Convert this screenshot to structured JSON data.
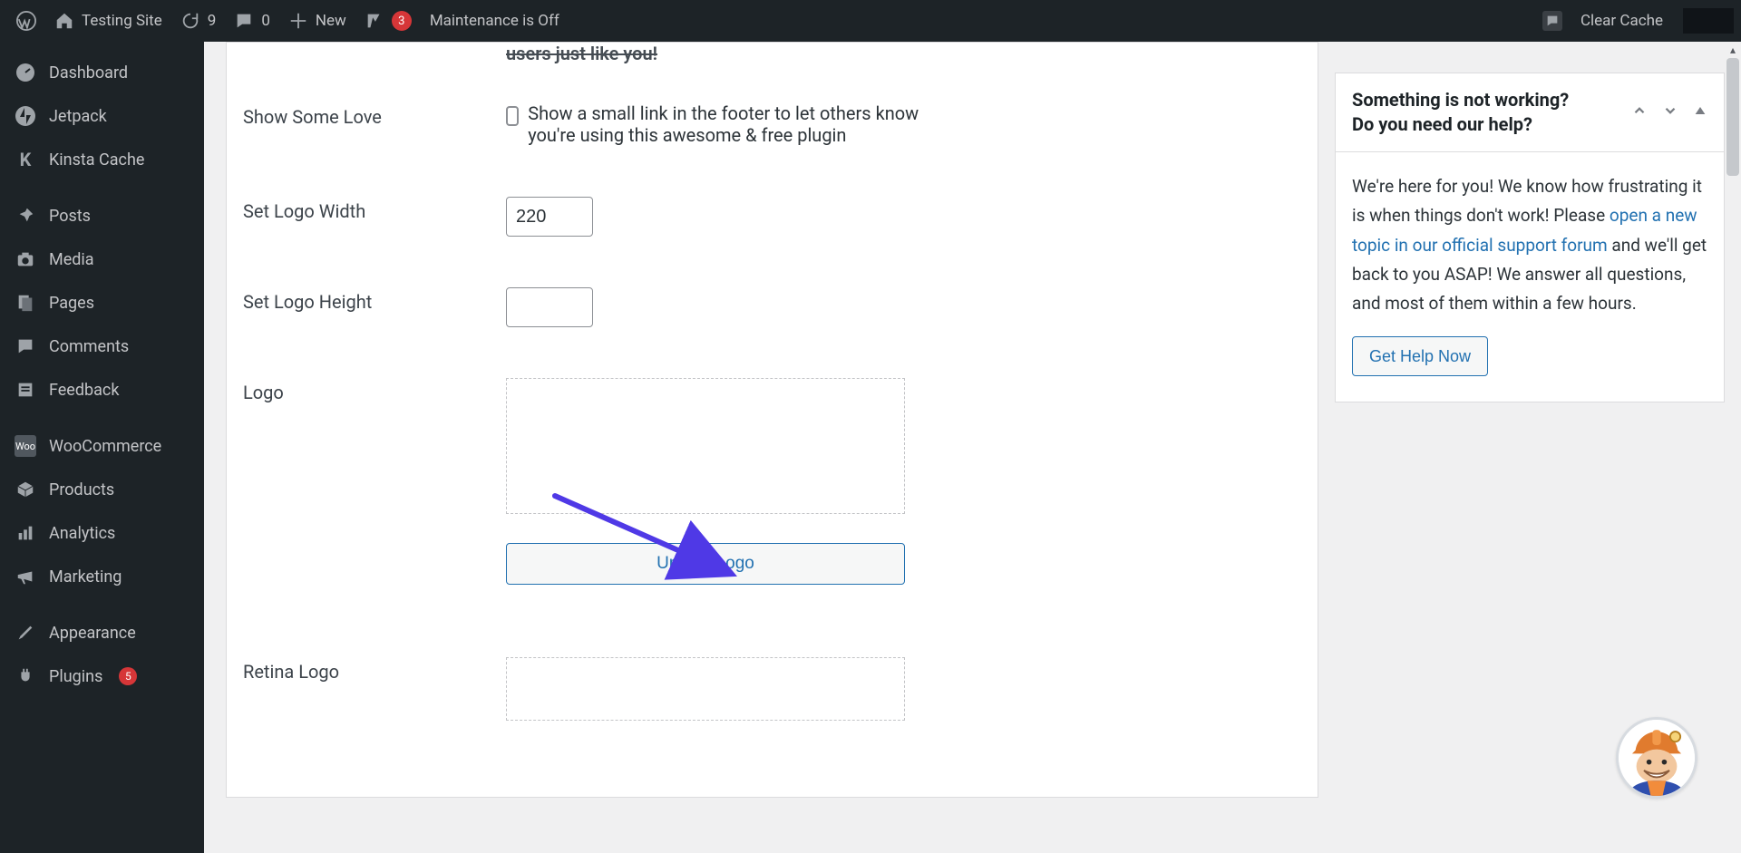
{
  "adminbar": {
    "site_title": "Testing Site",
    "updates_count": "9",
    "comments_count": "0",
    "new_label": "New",
    "yoast_count": "3",
    "maintenance_label": "Maintenance is Off",
    "clear_cache_label": "Clear Cache"
  },
  "menu": {
    "dashboard": "Dashboard",
    "jetpack": "Jetpack",
    "kinsta_cache": "Kinsta Cache",
    "posts": "Posts",
    "media": "Media",
    "pages": "Pages",
    "comments": "Comments",
    "feedback": "Feedback",
    "woocommerce": "WooCommerce",
    "products": "Products",
    "analytics": "Analytics",
    "marketing": "Marketing",
    "appearance": "Appearance",
    "plugins": "Plugins",
    "plugins_count": "5"
  },
  "form": {
    "truncated_top": "users just like you!",
    "show_love_label": "Show Some Love",
    "show_love_desc": "Show a small link in the footer to let others know you're using this awesome & free plugin",
    "logo_width_label": "Set Logo Width",
    "logo_width_value": "220",
    "logo_height_label": "Set Logo Height",
    "logo_height_value": "",
    "logo_label": "Logo",
    "upload_logo_label": "Upload Logo",
    "retina_logo_label": "Retina Logo"
  },
  "sidebox": {
    "title_line1": "Something is not working?",
    "title_line2": "Do you need our help?",
    "body_before_link": "We're here for you! We know how frustrating it is when things don't work! Please ",
    "link_text": "open a new topic in our official support forum",
    "body_after_link": " and we'll get back to you ASAP! We answer all questions, and most of them within a few hours.",
    "help_btn": "Get Help Now"
  },
  "colors": {
    "link": "#2271b1",
    "accent_arrow": "#4f39e6"
  }
}
